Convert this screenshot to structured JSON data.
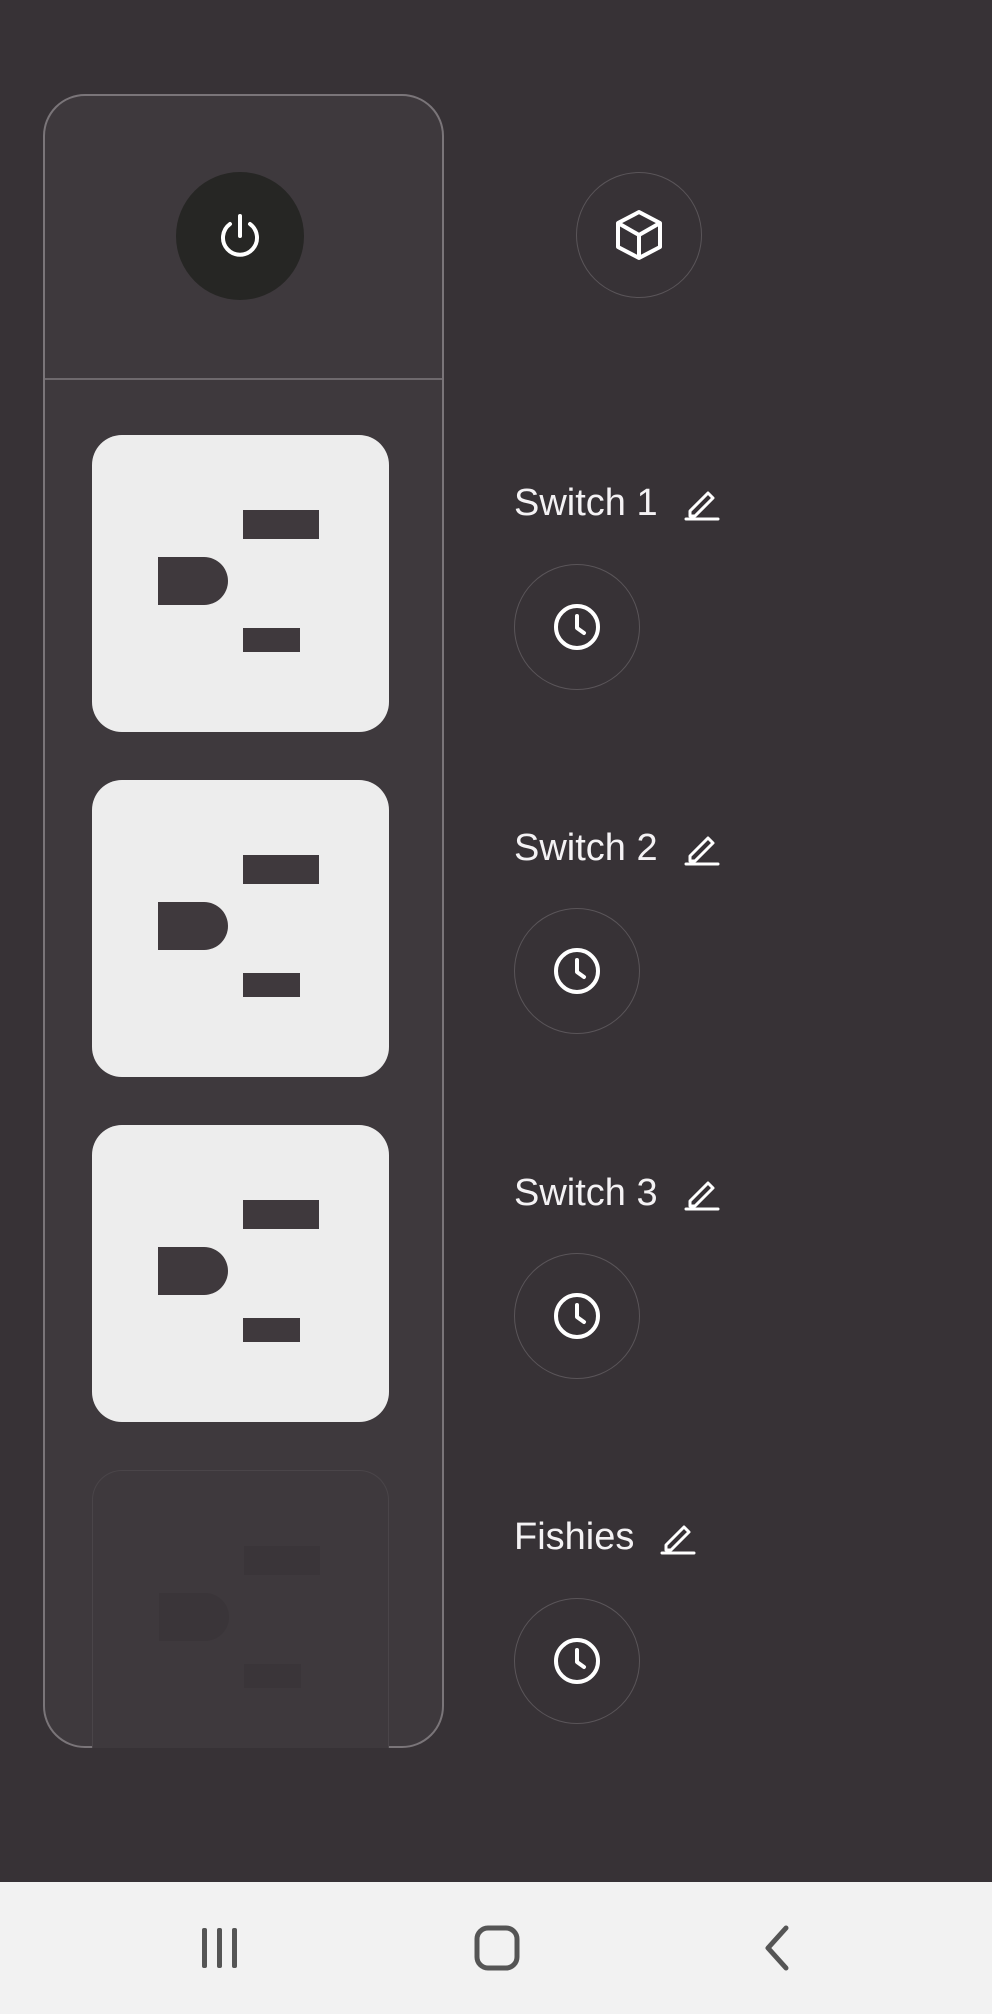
{
  "device": {
    "power_icon": "power-icon",
    "cube_icon": "cube-icon"
  },
  "outlets": [
    {
      "label": "Switch 1",
      "on": true
    },
    {
      "label": "Switch 2",
      "on": true
    },
    {
      "label": "Switch 3",
      "on": true
    },
    {
      "label": "Fishies",
      "on": false
    }
  ],
  "icons": {
    "edit": "edit-pencil-icon",
    "timer": "clock-icon"
  },
  "navbar": {
    "recent": "recent-apps-icon",
    "home": "home-icon",
    "back": "back-icon"
  },
  "colors": {
    "background": "#373236",
    "strip": "#3e393d",
    "outlet_on": "#ededed",
    "outlet_slot": "#3f393d",
    "text": "#f4f2f4",
    "navbar": "#f2f2f2"
  }
}
